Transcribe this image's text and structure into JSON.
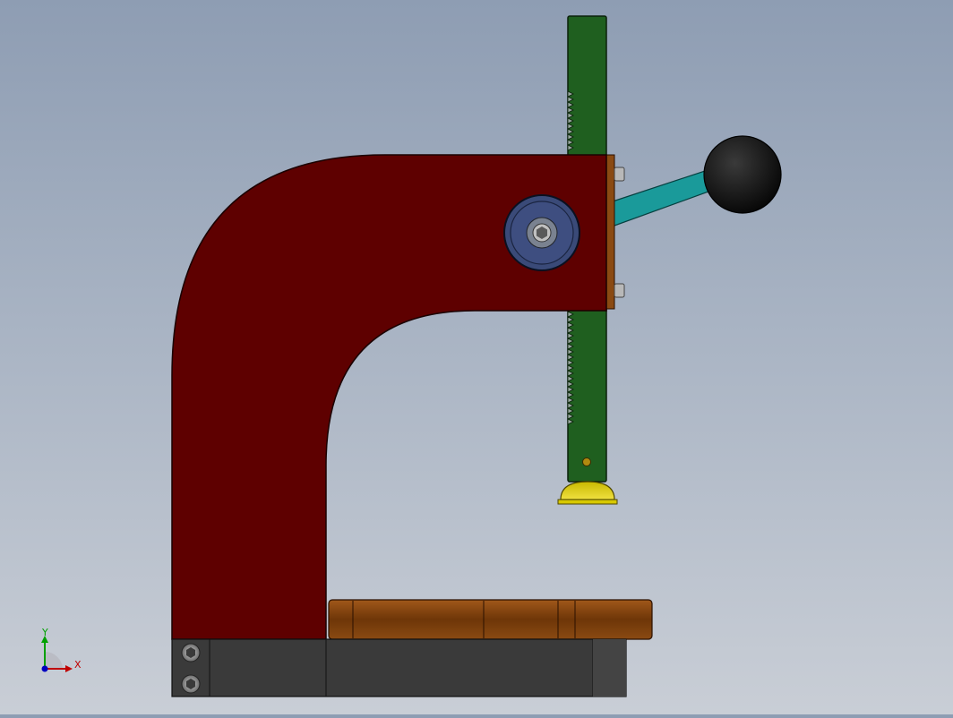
{
  "view": {
    "background_top": "#8e9db3",
    "background_bottom": "#c9ced6"
  },
  "model": {
    "frame_color": "#5e0000",
    "rack_color": "#1f5f1f",
    "handle_color": "#1a9a9a",
    "knob_color": "#111111",
    "anvil_color": "#8a4a10",
    "base_color": "#3a3a3a",
    "tip_color": "#d8c800",
    "bushing_color": "#3a4a78"
  },
  "triad": {
    "x_label": "X",
    "y_label": "Y",
    "x_color": "#c00000",
    "y_color": "#00a000",
    "z_color": "#0000c0"
  }
}
